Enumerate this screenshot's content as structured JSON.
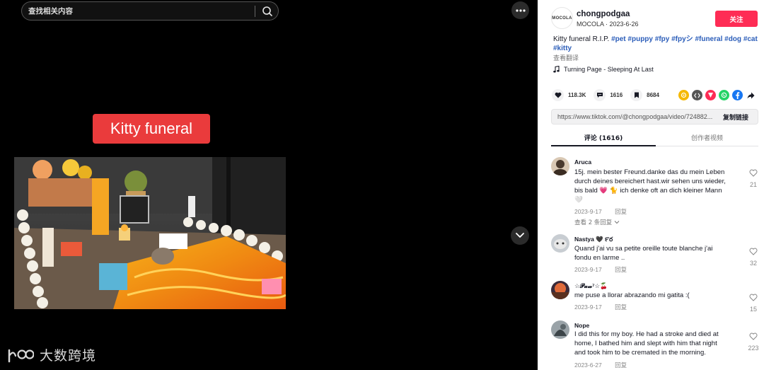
{
  "search": {
    "placeholder": "查找相关内容"
  },
  "video": {
    "caption": "Kitty funeral"
  },
  "watermark": {
    "text": "大数跨境"
  },
  "author": {
    "avatar_text": "MOCOLA",
    "username": "chongpodgaa",
    "meta": "MOCOLA · 2023-6-26",
    "follow_label": "关注"
  },
  "description": {
    "text": "Kitty funeral R.I.P.",
    "hashtags": [
      "#pet",
      "#puppy",
      "#fpy",
      "#fpyシ",
      "#funeral",
      "#dog",
      "#cat",
      "#kitty"
    ],
    "translate_label": "查看翻译",
    "music": "Turning Page - Sleeping At Last"
  },
  "stats": {
    "likes": "118.3K",
    "comments": "1616",
    "saves": "8684"
  },
  "share_icons": [
    {
      "name": "friends-share-icon",
      "color": "#f5b800"
    },
    {
      "name": "embed-icon",
      "color": "#555555"
    },
    {
      "name": "send-icon",
      "color": "#fe2c55"
    },
    {
      "name": "whatsapp-icon",
      "color": "#25d366"
    },
    {
      "name": "facebook-icon",
      "color": "#1877f2"
    },
    {
      "name": "share-arrow-icon",
      "color": "#161823"
    }
  ],
  "link": {
    "url": "https://www.tiktok.com/@chongpodgaa/video/724882...",
    "copy_label": "复制链接"
  },
  "tabs": {
    "comments": "评论 (1616)",
    "creator": "创作者视频"
  },
  "comments": [
    {
      "user": "Aruca",
      "lines": [
        "15j. mein bester Freund.danke das du mein Leben",
        "durch deines bereichert hast.wir sehen uns wieder,",
        "bis bald 💗 🐈 ich denke oft an dich kleiner Mann",
        "🤍"
      ],
      "date": "2023-9-17",
      "reply": "回复",
      "view_replies": "查看 2 条回复",
      "likes": "21"
    },
    {
      "user": "Nastya 🖤 ౯ర",
      "lines": [
        "Quand j'ai vu sa petite oreille toute blanche j'ai",
        "fondu en larme .."
      ],
      "date": "2023-9-17",
      "reply": "回复",
      "likes": "32"
    },
    {
      "user": "☆𝓟𝓪𝔀⁷☆🍒",
      "lines": [
        "me puse a llorar abrazando mi gatita :("
      ],
      "date": "2023-9-17",
      "reply": "回复",
      "likes": "15"
    },
    {
      "user": "Nope",
      "lines": [
        "I did this for my boy. He had a stroke and died at",
        "home, I bathed him and slept with him that night",
        "and took him to be cremated in the morning."
      ],
      "date": "2023-6-27",
      "reply": "回复",
      "likes": "223"
    }
  ]
}
